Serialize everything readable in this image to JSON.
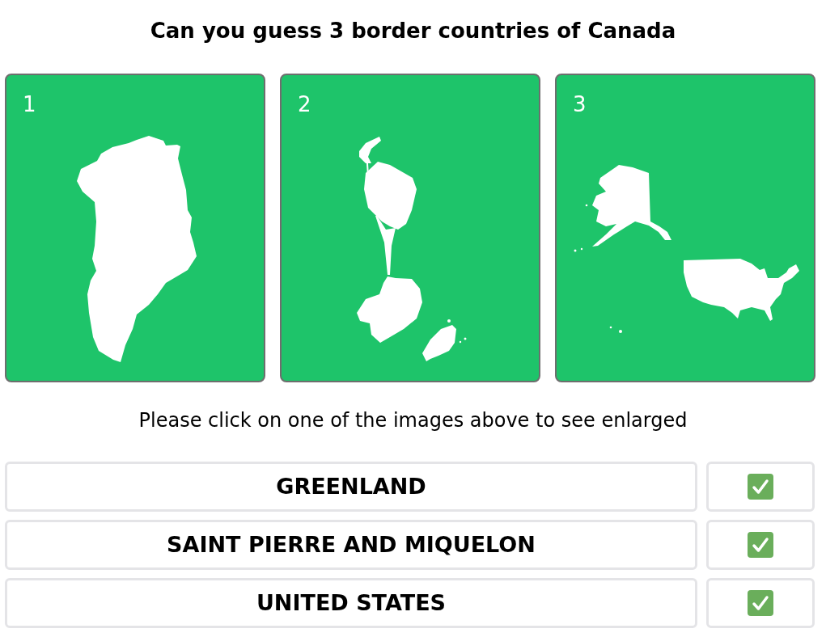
{
  "title": "Can you guess 3 border countries of Canada",
  "cards": [
    {
      "number": "1"
    },
    {
      "number": "2"
    },
    {
      "number": "3"
    }
  ],
  "instruction": "Please click on one of the images above to see enlarged",
  "answers": [
    {
      "text": "GREENLAND",
      "correct": true
    },
    {
      "text": "SAINT PIERRE AND MIQUELON",
      "correct": true
    },
    {
      "text": "UNITED STATES",
      "correct": true
    }
  ]
}
